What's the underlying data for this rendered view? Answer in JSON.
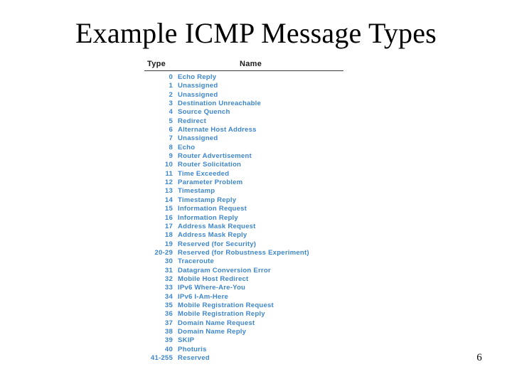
{
  "slide": {
    "title": "Example ICMP Message Types",
    "page_number": "6",
    "background_color": "#ffffff"
  },
  "table": {
    "columns": [
      "Type",
      "Name"
    ],
    "header_color": "#1a1a1a",
    "row_color": "#3E87CE",
    "rule_color": "#3a3a3a",
    "rows": [
      {
        "type": "0",
        "name": "Echo Reply"
      },
      {
        "type": "1",
        "name": "Unassigned"
      },
      {
        "type": "2",
        "name": "Unassigned"
      },
      {
        "type": "3",
        "name": "Destination Unreachable"
      },
      {
        "type": "4",
        "name": "Source Quench"
      },
      {
        "type": "5",
        "name": "Redirect"
      },
      {
        "type": "6",
        "name": "Alternate Host Address"
      },
      {
        "type": "7",
        "name": "Unassigned"
      },
      {
        "type": "8",
        "name": "Echo"
      },
      {
        "type": "9",
        "name": "Router Advertisement"
      },
      {
        "type": "10",
        "name": "Router Solicitation"
      },
      {
        "type": "11",
        "name": "Time Exceeded"
      },
      {
        "type": "12",
        "name": "Parameter Problem"
      },
      {
        "type": "13",
        "name": "Timestamp"
      },
      {
        "type": "14",
        "name": "Timestamp Reply"
      },
      {
        "type": "15",
        "name": "Information Request"
      },
      {
        "type": "16",
        "name": "Information Reply"
      },
      {
        "type": "17",
        "name": "Address Mask Request"
      },
      {
        "type": "18",
        "name": "Address Mask Reply"
      },
      {
        "type": "19",
        "name": "Reserved (for Security)"
      },
      {
        "type": "20-29",
        "name": "Reserved (for Robustness Experiment)"
      },
      {
        "type": "30",
        "name": "Traceroute"
      },
      {
        "type": "31",
        "name": "Datagram Conversion Error"
      },
      {
        "type": "32",
        "name": "Mobile Host Redirect"
      },
      {
        "type": "33",
        "name": "IPv6 Where-Are-You"
      },
      {
        "type": "34",
        "name": "IPv6 I-Am-Here"
      },
      {
        "type": "35",
        "name": "Mobile Registration Request"
      },
      {
        "type": "36",
        "name": "Mobile Registration Reply"
      },
      {
        "type": "37",
        "name": "Domain Name Request"
      },
      {
        "type": "38",
        "name": "Domain Name Reply"
      },
      {
        "type": "39",
        "name": "SKIP"
      },
      {
        "type": "40",
        "name": "Photuris"
      },
      {
        "type": "41-255",
        "name": "Reserved"
      }
    ]
  }
}
